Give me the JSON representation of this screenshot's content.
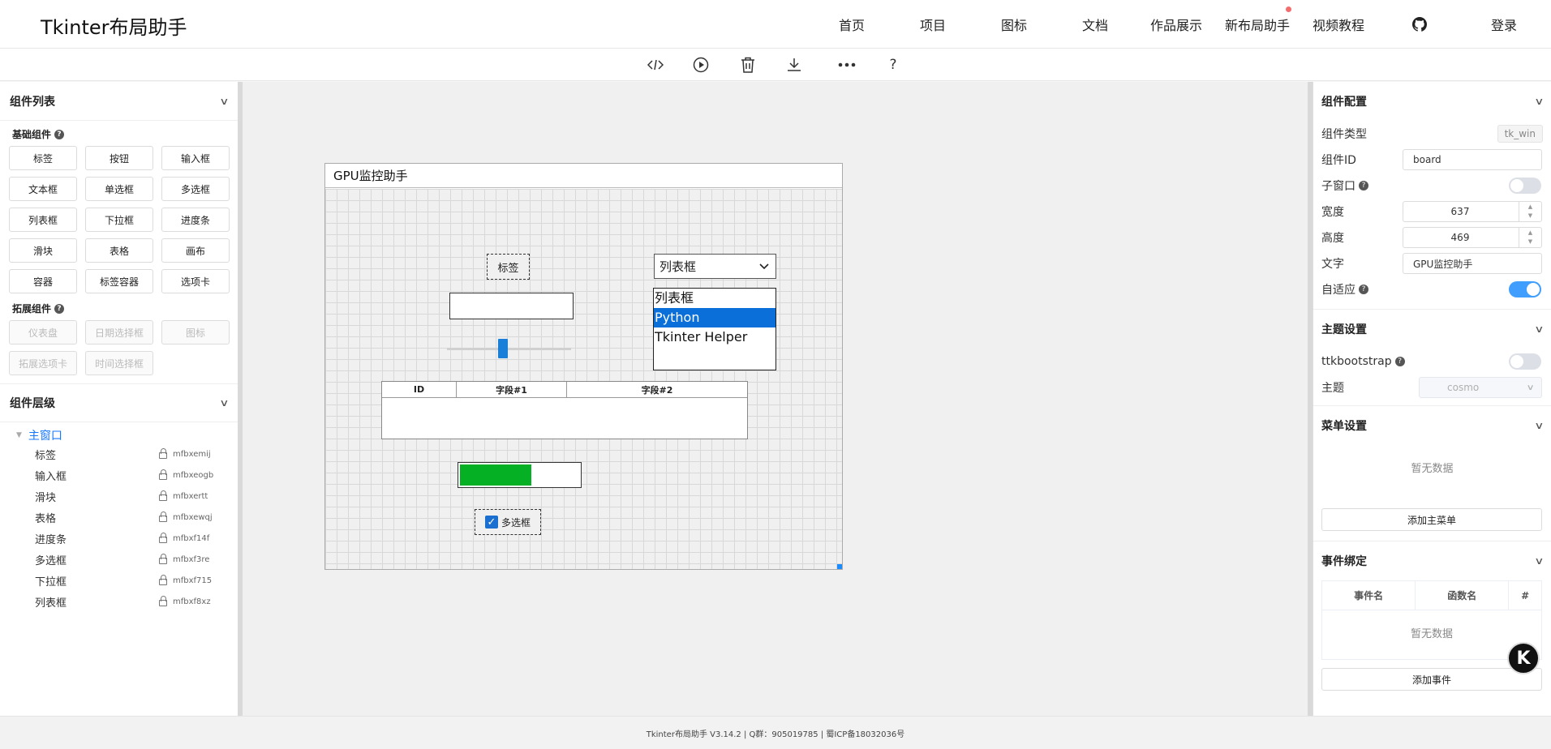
{
  "header": {
    "brand": "Tkinter布局助手",
    "nav": [
      "首页",
      "项目",
      "图标",
      "文档",
      "作品展示",
      "新布局助手",
      "视频教程"
    ],
    "login": "登录"
  },
  "toolbar": {
    "icons": [
      "code-icon",
      "play-icon",
      "trash-icon",
      "download-icon",
      "more-icon",
      "help-icon"
    ],
    "help_label": "?"
  },
  "left": {
    "components_title": "组件列表",
    "basic_title": "基础组件",
    "basic": [
      "标签",
      "按钮",
      "输入框",
      "文本框",
      "单选框",
      "多选框",
      "列表框",
      "下拉框",
      "进度条",
      "滑块",
      "表格",
      "画布",
      "容器",
      "标签容器",
      "选项卡"
    ],
    "ext_title": "拓展组件",
    "ext": [
      "仪表盘",
      "日期选择框",
      "图标",
      "拓展选项卡",
      "时间选择框"
    ],
    "layers_title": "组件层级",
    "root": "主窗口",
    "layers": [
      {
        "name": "标签",
        "id": "mfbxemij"
      },
      {
        "name": "输入框",
        "id": "mfbxeogb"
      },
      {
        "name": "滑块",
        "id": "mfbxertt"
      },
      {
        "name": "表格",
        "id": "mfbxewqj"
      },
      {
        "name": "进度条",
        "id": "mfbxf14f"
      },
      {
        "name": "多选框",
        "id": "mfbxf3re"
      },
      {
        "name": "下拉框",
        "id": "mfbxf715"
      },
      {
        "name": "列表框",
        "id": "mfbxf8xz"
      }
    ]
  },
  "canvas": {
    "window_title": "GPU监控助手",
    "label_text": "标签",
    "combo_value": "列表框",
    "listbox": [
      "列表框",
      "Python",
      "Tkinter Helper"
    ],
    "listbox_selected_index": 1,
    "table_columns": [
      "ID",
      "字段#1",
      "字段#2"
    ],
    "progress": 0.6,
    "slider": 0.45,
    "checkbox_label": "多选框",
    "checkbox_checked": true
  },
  "right": {
    "config_title": "组件配置",
    "type_label": "组件类型",
    "type_value": "tk_win",
    "id_label": "组件ID",
    "id_value": "board",
    "child_label": "子窗口",
    "width_label": "宽度",
    "width_value": "637",
    "height_label": "高度",
    "height_value": "469",
    "text_label": "文字",
    "text_value": "GPU监控助手",
    "auto_label": "自适应",
    "theme_title": "主题设置",
    "ttkb_label": "ttkbootstrap",
    "theme_label": "主题",
    "theme_value": "cosmo",
    "menu_title": "菜单设置",
    "menu_empty": "暂无数据",
    "add_menu": "添加主菜单",
    "event_title": "事件绑定",
    "event_cols": [
      "事件名",
      "函数名",
      "#"
    ],
    "event_empty": "暂无数据",
    "add_event": "添加事件"
  },
  "footer": {
    "text": "Tkinter布局助手 V3.14.2 | Q群：905019785 | 蜀ICP备18032036号"
  },
  "colors": {
    "accent": "#409eff",
    "link": "#1677ff",
    "selection": "#0a6fd8",
    "progress": "#06b025"
  }
}
